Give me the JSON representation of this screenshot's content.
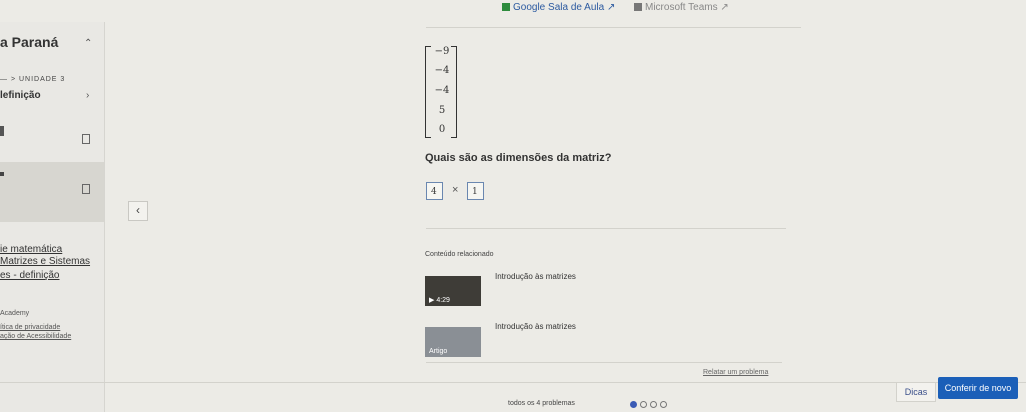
{
  "topbar": {
    "google": "Google Sala de Aula",
    "teams": "Microsoft Teams"
  },
  "sidebar": {
    "title": "a Paraná",
    "unit": "— > UNIDADE 3",
    "section": "lefinição",
    "links": [
      "ie matemática",
      "Matrizes e Sistemas",
      "es - definição"
    ],
    "academy": "Academy",
    "policy": [
      "ítica de privacidade",
      "ação de Acessibilidade"
    ]
  },
  "exercise": {
    "matrix": [
      "−9",
      "−4",
      "−4",
      "5",
      "0"
    ],
    "question": "Quais são as dimensões da matriz?",
    "answer_rows": "4",
    "answer_cols": "1",
    "times": "×"
  },
  "related": {
    "heading": "Conteúdo relacionado",
    "items": [
      {
        "title": "Introdução às matrizes",
        "badge": "▶ 4:29"
      },
      {
        "title": "Introdução às matrizes",
        "badge": "Artigo"
      }
    ]
  },
  "report": "Relatar um problema",
  "footer": {
    "progress": "todos os 4 problemas",
    "hint": "Dicas",
    "check": "Conferir de novo"
  }
}
